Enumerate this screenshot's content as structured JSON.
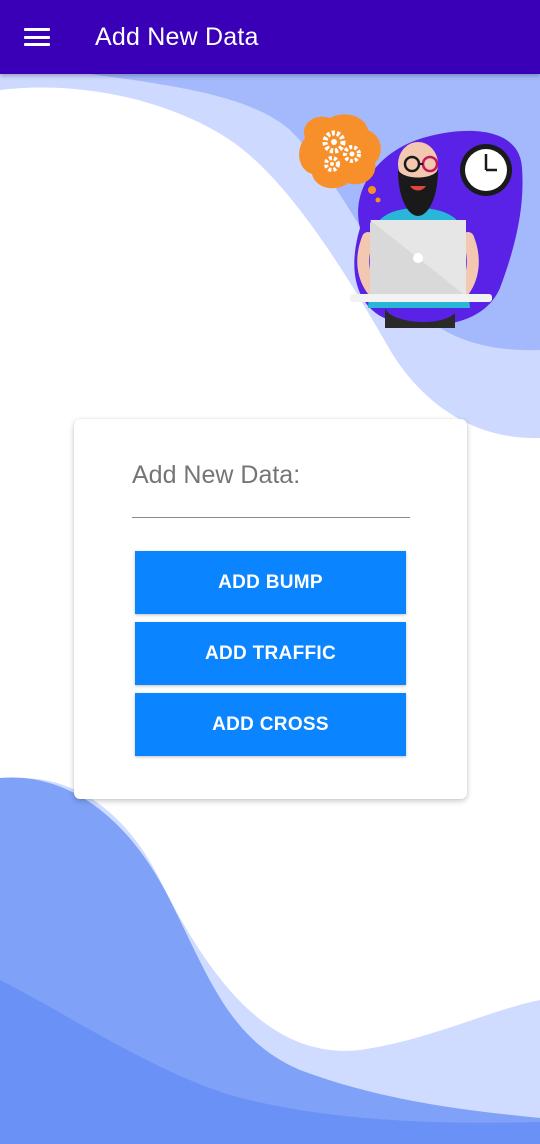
{
  "appbar": {
    "title": "Add New Data",
    "menu_icon": "hamburger-menu-icon",
    "background_color": "#3a00b8"
  },
  "card": {
    "input_placeholder": "Add New Data:",
    "buttons": [
      {
        "label": "ADD BUMP"
      },
      {
        "label": "ADD TRAFFIC"
      },
      {
        "label": "ADD CROSS"
      }
    ],
    "button_color": "#0a84ff"
  },
  "illustration": {
    "icons": [
      "gears-icon",
      "clock-icon",
      "laptop-icon"
    ]
  }
}
